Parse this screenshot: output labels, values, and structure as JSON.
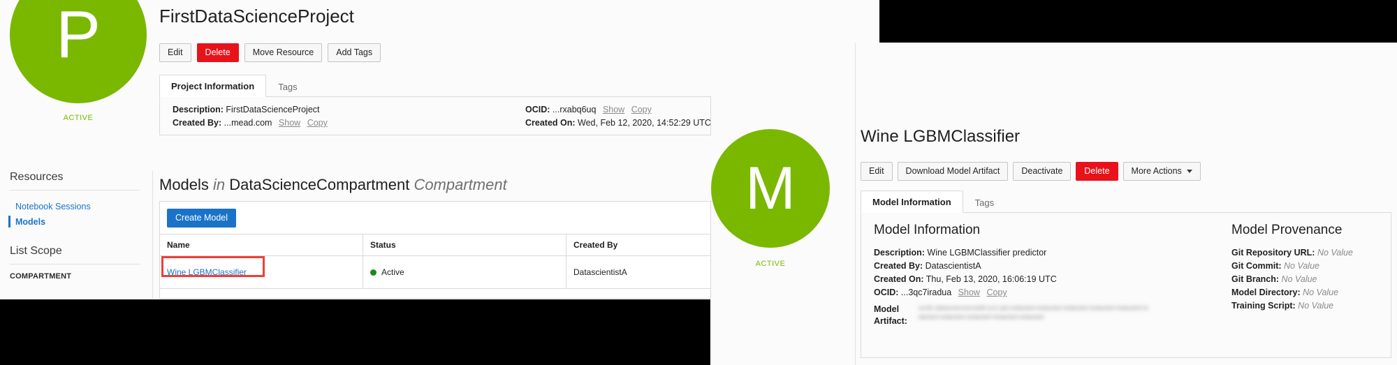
{
  "project": {
    "avatar_letter": "P",
    "avatar_state": "ACTIVE",
    "title": "FirstDataScienceProject",
    "buttons": [
      {
        "label": "Edit",
        "style": "default"
      },
      {
        "label": "Delete",
        "style": "danger"
      },
      {
        "label": "Move Resource",
        "style": "default"
      },
      {
        "label": "Add Tags",
        "style": "default"
      }
    ],
    "tabs": [
      {
        "label": "Project Information",
        "active": true
      },
      {
        "label": "Tags",
        "active": false
      }
    ],
    "details": {
      "description_label": "Description:",
      "description_value": "FirstDataScienceProject",
      "created_by_label": "Created By:",
      "created_by_value": "...mead.com",
      "ocid_label": "OCID:",
      "ocid_value": "...rxabq6uq",
      "created_on_label": "Created On:",
      "created_on_value": "Wed, Feb 12, 2020, 14:52:29 UTC",
      "show_link": "Show",
      "copy_link": "Copy"
    }
  },
  "sidebar": {
    "resources_heading": "Resources",
    "items": [
      {
        "label": "Notebook Sessions",
        "active": false
      },
      {
        "label": "Models",
        "active": true
      }
    ],
    "list_scope_heading": "List Scope",
    "compartment_label": "COMPARTMENT"
  },
  "models_section": {
    "heading_word1": "Models",
    "heading_in": "in",
    "heading_compartment_name": "DataScienceCompartment",
    "heading_word2": "Compartment",
    "create_button": "Create Model",
    "columns": [
      "Name",
      "Status",
      "Created By"
    ],
    "rows": [
      {
        "name": "Wine LGBMClassifier",
        "status": "Active",
        "created_by": "DatascientistA",
        "highlighted": true
      }
    ],
    "highlight_color": "#ef3f37",
    "status_color": "#1a8a1a",
    "link_color": "#1a73c8"
  },
  "model": {
    "avatar_letter": "M",
    "avatar_state": "ACTIVE",
    "title": "Wine LGBMClassifier",
    "buttons": [
      {
        "label": "Edit",
        "style": "default"
      },
      {
        "label": "Download Model Artifact",
        "style": "default"
      },
      {
        "label": "Deactivate",
        "style": "default"
      },
      {
        "label": "Delete",
        "style": "danger"
      },
      {
        "label": "More Actions",
        "style": "dropdown"
      }
    ],
    "tabs": [
      {
        "label": "Model Information",
        "active": true
      },
      {
        "label": "Tags",
        "active": false
      }
    ],
    "information": {
      "section_title": "Model Information",
      "description_label": "Description:",
      "description_value": "Wine LGBMClassifier predictor",
      "created_by_label": "Created By:",
      "created_by_value": "DatascientistA",
      "created_on_label": "Created On:",
      "created_on_value": "Thu, Feb 13, 2020, 16:06:19 UTC",
      "ocid_label": "OCID:",
      "ocid_value": "...3qc7iradua",
      "show_link": "Show",
      "copy_link": "Copy",
      "artifact_label_line1": "Model",
      "artifact_label_line2": "Artifact:",
      "artifact_value": "ocid1.datasciencemodel.oc1.iad.redacted-redacted-redacted-redacted-redacted-redacted-redacted-redacted-redacted-redacted"
    },
    "provenance": {
      "section_title": "Model Provenance",
      "rows": [
        {
          "label": "Git Repository URL:",
          "value": "No Value"
        },
        {
          "label": "Git Commit:",
          "value": "No Value"
        },
        {
          "label": "Git Branch:",
          "value": "No Value"
        },
        {
          "label": "Model Directory:",
          "value": "No Value"
        },
        {
          "label": "Training Script:",
          "value": "No Value"
        }
      ]
    }
  },
  "theme": {
    "accent_green": "#7ab800",
    "link_blue": "#1a73c8",
    "danger_red": "#e8121a",
    "active_green": "#1a8a1a",
    "highlight_red": "#ef3f37"
  }
}
